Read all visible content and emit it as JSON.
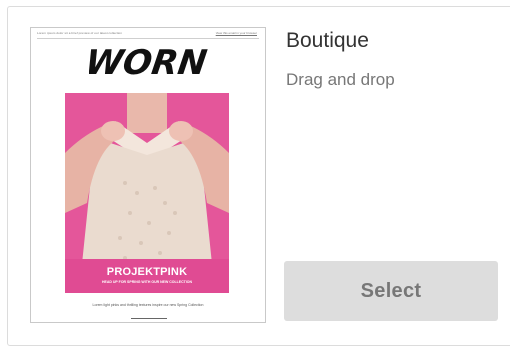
{
  "template": {
    "name": "Boutique",
    "type": "Drag and drop",
    "select_label": "Select"
  },
  "thumbnail": {
    "preheader": "Lorem ipsum dolor sit a brief preview of our latest collection",
    "view_online": "View this email in your browser",
    "logo_text": "WORN",
    "hero_title": "PROJEKTPINK",
    "hero_subtitle": "HEAD UP FOR SPRING WITH OUR NEW COLLECTION",
    "footer_text": "Lorem light pinks and thrilling textures inspire our new Spring Collection",
    "colors": {
      "hero": "#e4569a",
      "button": "#dddddd"
    }
  }
}
